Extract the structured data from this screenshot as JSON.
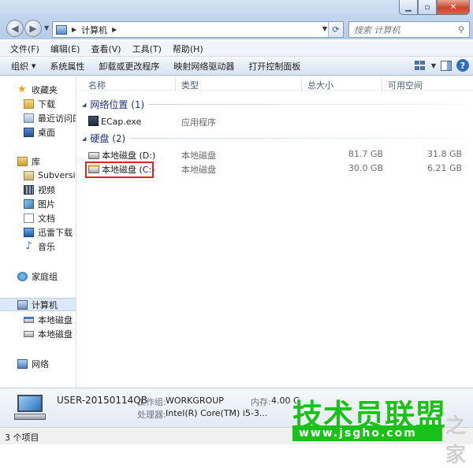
{
  "address": {
    "location": "计算机"
  },
  "search": {
    "placeholder": "搜索 计算机"
  },
  "menubar": [
    "文件(F)",
    "编辑(E)",
    "查看(V)",
    "工具(T)",
    "帮助(H)"
  ],
  "commandbar": {
    "organize": "组织",
    "system_properties": "系统属性",
    "uninstall": "卸载或更改程序",
    "map_drive": "映射网络驱动器",
    "control_panel": "打开控制面板"
  },
  "navpane": {
    "favorites": "收藏夹",
    "downloads": "下载",
    "recent": "最近访问的",
    "desktop": "桌面",
    "libraries": "库",
    "subversion": "Subversion",
    "videos": "视频",
    "pictures": "图片",
    "documents": "文档",
    "thunder": "迅雷下载",
    "music": "音乐",
    "homegroup": "家庭组",
    "computer": "计算机",
    "drive_c": "本地磁盘 (C",
    "drive_d": "本地磁盘 (D",
    "network": "网络"
  },
  "columns": {
    "name": "名称",
    "type": "类型",
    "total": "总大小",
    "free": "可用空间"
  },
  "groups": {
    "network": "网络位置 (1)",
    "disks": "硬盘 (2)"
  },
  "items": {
    "ecap": {
      "name": "ECap.exe",
      "type": "应用程序"
    },
    "drive_d": {
      "name": "本地磁盘 (D:)",
      "type": "本地磁盘",
      "total": "81.7 GB",
      "free": "31.8 GB"
    },
    "drive_c": {
      "name": "本地磁盘 (C:)",
      "type": "本地磁盘",
      "total": "30.0 GB",
      "free": "6.21 GB"
    }
  },
  "details": {
    "pc_name": "USER-20150114QB",
    "workgroup_label": "工作组:",
    "workgroup": "WORKGROUP",
    "memory_label": "内存:",
    "memory": "4.00 G",
    "cpu_label": "处理器:",
    "cpu": "Intel(R) Core(TM) i5-3..."
  },
  "status": {
    "count": "3 个项目"
  },
  "watermark": {
    "title": "技术员联盟",
    "url": "www.jsgho.com",
    "home": "之家"
  }
}
